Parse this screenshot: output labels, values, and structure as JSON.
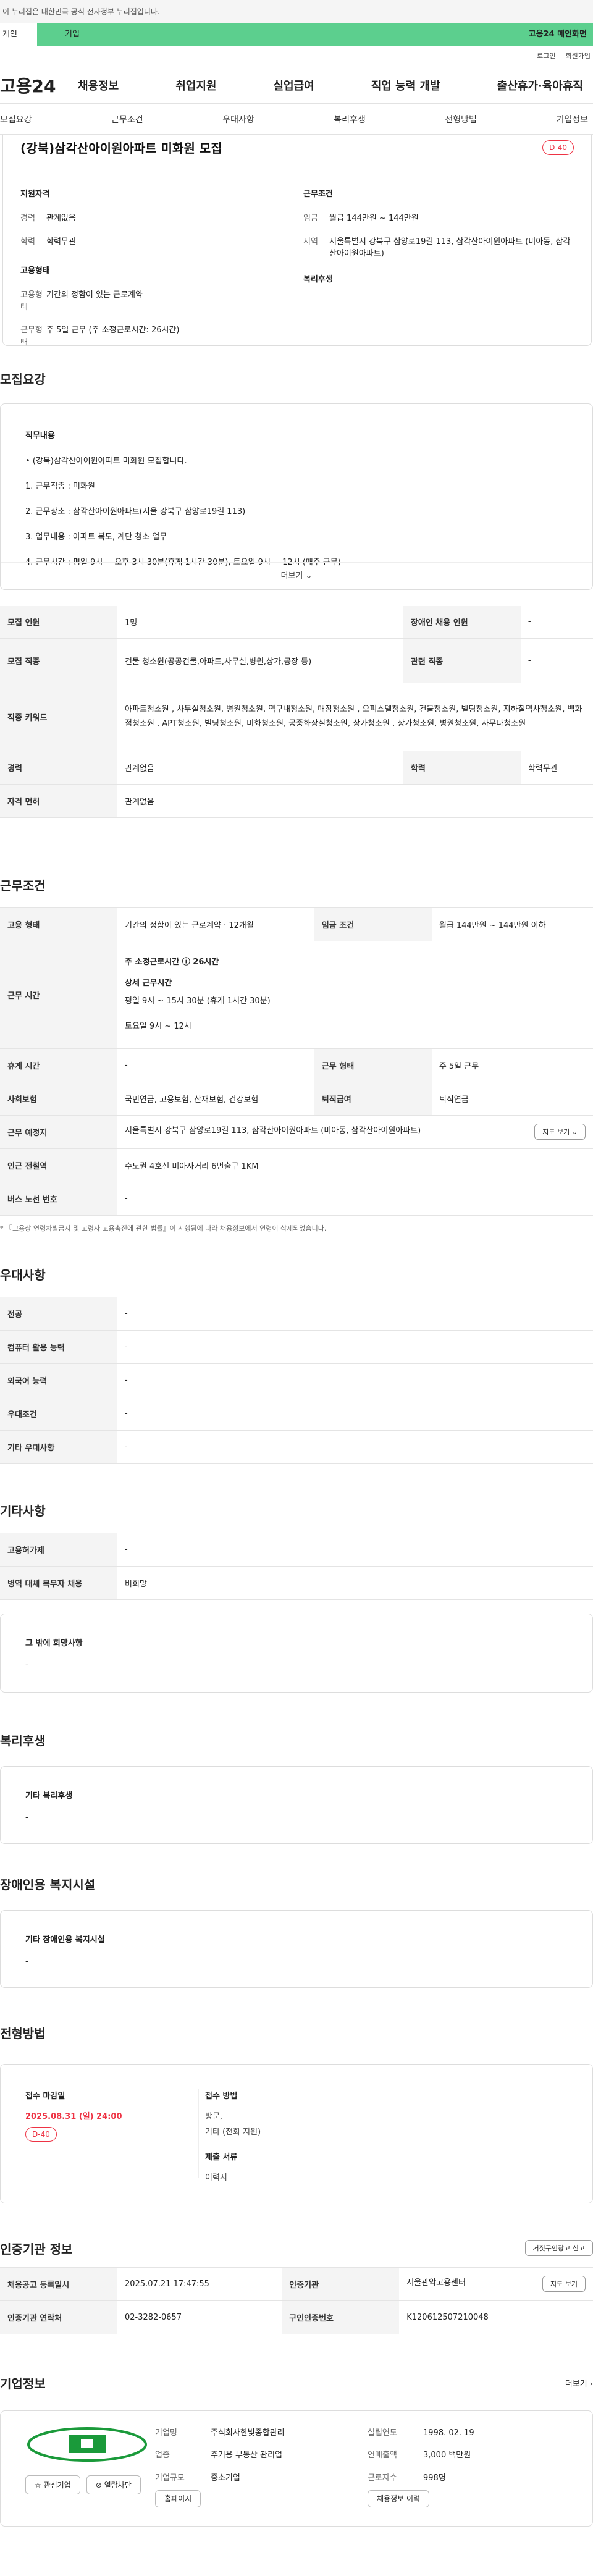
{
  "gov_banner": "이 누리집은 대한민국 공식 전자정부 누리집입니다.",
  "tabs": {
    "personal": "개인",
    "corp": "기업",
    "corp_link": "고용24 메인화면"
  },
  "util": {
    "login": "로그인",
    "join": "회원가입"
  },
  "logo": "고용24",
  "gnb": [
    "채용정보",
    "취업지원",
    "실업급여",
    "직업 능력 개발",
    "출산휴가·육아휴직"
  ],
  "lnb": [
    "모집요강",
    "근무조건",
    "우대사항",
    "복리후생",
    "전형방법",
    "기업정보"
  ],
  "job": {
    "title": "(강북)삼각산아이원아파트 미화원 모집",
    "dday": "D-40",
    "qual_title": "지원자격",
    "career_k": "경력",
    "career_v": "관계없음",
    "edu_k": "학력",
    "edu_v": "학력무관",
    "emp_title": "고용형태",
    "emp_k": "고용형태",
    "emp_v": "기간의 정함이 있는 근로계약",
    "hours_k": "근무형태",
    "hours_v": "주 5일 근무 (주 소정근로시간: 26시간)",
    "cond_title": "근무조건",
    "wage_k": "임금",
    "wage_v": "월급 144만원 ~ 144만원",
    "loc_k": "지역",
    "loc_v": "서울특별시 강북구 삼양로19길 113, 삼각산아이원아파트 (미아동, 삼각산아이원아파트)",
    "welfare_title": "복리후생"
  },
  "summary": {
    "title": "모집요강",
    "lbl": "직무내용",
    "lines": [
      "• (강북)삼각산아이원아파트 미화원 모집합니다.",
      "1. 근무직종 : 미화원",
      "2. 근무장소 : 삼각산아이원아파트(서울 강북구 삼양로19길 113)",
      "3. 업무내용 : 아파트 복도, 계단 청소 업무",
      "4. 근무시간 : 평일 9시 ~ 오후 3시 30분(휴게 1시간 30분), 토요일 9시 ~ 12시 (매주 근무)"
    ],
    "more": "더보기 ⌄"
  },
  "recruit_table": {
    "count_k": "모집 인원",
    "count_v": "1명",
    "hire_k": "장애인 채용 인원",
    "hire_v": "-",
    "job_k": "모집 직종",
    "job_v": "건물 청소원(공공건물,아파트,사무실,병원,상가,공장 등)",
    "rel_k": "관련 직종",
    "rel_v": "-",
    "kw_k": "직종 키워드",
    "kw_v": "아파트청소원 , 사무실청소원, 병원청소원, 역구내청소원, 매장청소원 , 오피스텔청소원, 건물청소원, 빌딩청소원, 지하철역사청소원, 백화점청소원 , APT청소원, 빌딩청소원, 미화청소원, 공중화장실청소원, 상가청소원 , 상가청소원, 병원청소원, 사무나청소원",
    "car_k": "경력",
    "car_v": "관계없음",
    "edu_k": "학력",
    "edu_v": "학력무관",
    "cert_k": "자격 면허",
    "cert_v": "관계없음"
  },
  "cond": {
    "title": "근무조건",
    "type_k": "고용 형태",
    "type_v": "기간의 정함이 있는 근로계약 · 12개월",
    "wage_k": "임금 조건",
    "wage_v": "월급 144만원 ~ 144만원 이하",
    "time_k": "근무 시간",
    "time_a": "주 소정근로시간 ⓘ 26시간",
    "time_b": "상세 근무시간",
    "time_c": "평일 9시 ~ 15시 30분 (휴게 1시간 30분)",
    "time_d": "토요일 9시 ~ 12시",
    "rest_k": "휴게 시간",
    "rest_v": "-",
    "form_k": "근무 형태",
    "form_v": "주 5일 근무",
    "ins_k": "사회보험",
    "ins_v": "국민연금, 고용보험, 산재보험, 건강보험",
    "ret_k": "퇴직급여",
    "ret_v": "퇴직연금",
    "addr_k": "근무 예정지",
    "addr_v": "서울특별시 강북구 삼양로19길 113, 삼각산아이원아파트 (미아동, 삼각산아이원아파트)",
    "map_btn": "지도 보기 ⌄",
    "sub_k": "인근 전철역",
    "sub_v": "수도권 4호선 미아사거리 6번출구 1KM",
    "bus_k": "버스 노선 번호",
    "bus_v": "-",
    "note": "* 『고용상 연령차별금지 및 고령자 고용촉진에 관한 법률』이 시행됨에 따라 채용정보에서 연령이 삭제되었습니다."
  },
  "pref": {
    "title": "우대사항",
    "rows": [
      [
        "전공",
        "-"
      ],
      [
        "컴퓨터 활용 능력",
        "-"
      ],
      [
        "외국어 능력",
        "-"
      ],
      [
        "우대조건",
        "-"
      ],
      [
        "기타 우대사항",
        "-"
      ]
    ]
  },
  "etc": {
    "title": "기타사항",
    "rows": [
      [
        "고용허가제",
        "-"
      ],
      [
        "병역 대체 복무자 채용",
        "비희망"
      ]
    ],
    "box_lbl": "그 밖에 희망사항",
    "box_v": "-"
  },
  "welfare": {
    "title": "복리후생",
    "lbl": "기타 복리후생",
    "v": "-"
  },
  "disab": {
    "title": "장애인용 복지시설",
    "lbl": "기타 장애인용 복지시설",
    "v": "-"
  },
  "guide": {
    "title": "전형방법",
    "close_lbl": "접수 마감일",
    "close_v": "2025.08.31 (일) 24:00",
    "dday": "D-40",
    "method_lbl": "접수 방법",
    "method_v1": "방문,",
    "method_v2": "기타 (전화 지원)",
    "docs_lbl": "제출 서류",
    "docs_v": "이력서"
  },
  "cert": {
    "title": "인증기관 정보",
    "report": "거짓구인광고 신고",
    "reg_k": "채용공고 등록일시",
    "reg_v": "2025.07.21 17:47:55",
    "org_k": "인증기관",
    "org_v": "서울관악고용센터",
    "map": "지도 보기",
    "tel_k": "인증기관 연락처",
    "tel_v": "02-3282-0657",
    "no_k": "구인인증번호",
    "no_v": "K120612507210048"
  },
  "company": {
    "title": "기업정보",
    "more": "더보기 ›",
    "name_k": "기업명",
    "name_v": "주식회사한빛종합관리",
    "est_k": "설립연도",
    "est_v": "1998. 02. 19",
    "ind_k": "업종",
    "ind_v": "주거용 부동산 관리업",
    "rev_k": "연매출액",
    "rev_v": "3,000 백만원",
    "emp_k": "근로자수",
    "emp_v": "998명",
    "size_k": "기업규모",
    "size_v": "중소기업",
    "fav": "☆ 관심기업",
    "block": "⊘ 열람차단",
    "home": "홈페이지",
    "jobs": "채용정보 이력"
  }
}
